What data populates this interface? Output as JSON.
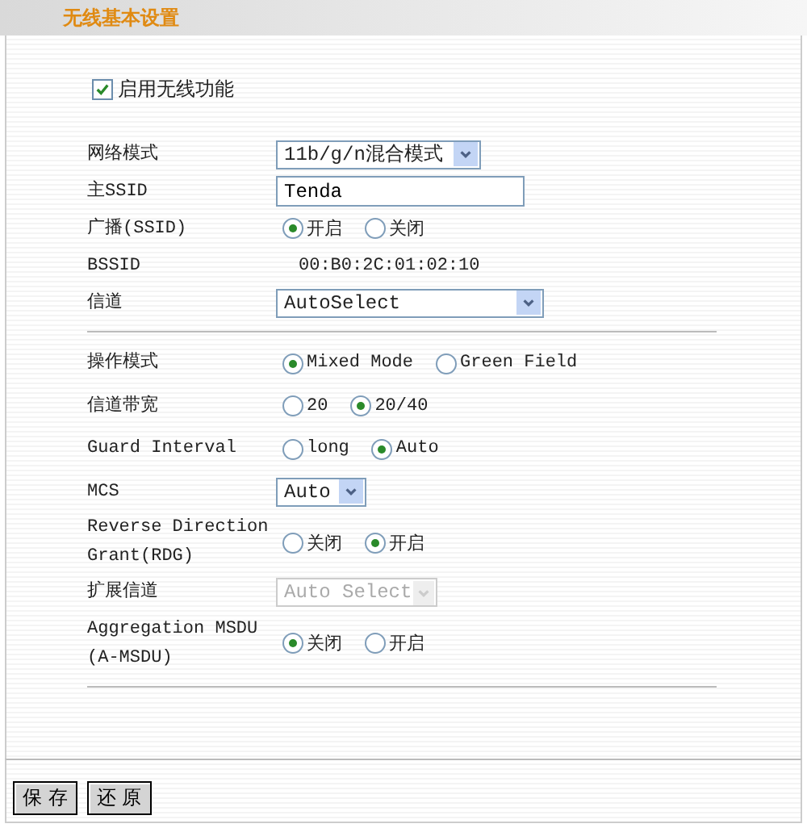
{
  "title": "无线基本设置",
  "enable_wireless": {
    "label": "启用无线功能",
    "checked": true
  },
  "basic_settings": [
    {
      "kind": "select",
      "label": "网络模式",
      "value": "11b/g/n混合模式",
      "disabled": false
    },
    {
      "kind": "input",
      "label": "主SSID",
      "value": "Tenda"
    },
    {
      "kind": "radio",
      "label": "广播(SSID)",
      "options": [
        {
          "label": "开启",
          "selected": true
        },
        {
          "label": "关闭",
          "selected": false
        }
      ]
    },
    {
      "kind": "static",
      "label": "BSSID",
      "value": "00:B0:2C:01:02:10"
    },
    {
      "kind": "select",
      "label": "信道",
      "value": "AutoSelect",
      "disabled": false
    }
  ],
  "advanced_settings": [
    {
      "kind": "radio",
      "label": "操作模式",
      "options": [
        {
          "label": "Mixed Mode",
          "selected": true
        },
        {
          "label": "Green Field",
          "selected": false
        }
      ]
    },
    {
      "kind": "radio",
      "label": "信道带宽",
      "options": [
        {
          "label": "20",
          "selected": false
        },
        {
          "label": "20/40",
          "selected": true
        }
      ]
    },
    {
      "kind": "radio",
      "label": "Guard Interval",
      "options": [
        {
          "label": "long",
          "selected": false
        },
        {
          "label": "Auto",
          "selected": true
        }
      ]
    },
    {
      "kind": "select",
      "label": "MCS",
      "value": "Auto",
      "disabled": false
    },
    {
      "kind": "radio",
      "label": "Reverse Direction Grant(RDG)",
      "options": [
        {
          "label": "关闭",
          "selected": false
        },
        {
          "label": "开启",
          "selected": true
        }
      ]
    },
    {
      "kind": "select",
      "label": "扩展信道",
      "value": "Auto Select",
      "disabled": true
    },
    {
      "kind": "radio",
      "label": "Aggregation MSDU (A-MSDU)",
      "options": [
        {
          "label": "关闭",
          "selected": true
        },
        {
          "label": "开启",
          "selected": false
        }
      ]
    }
  ],
  "buttons": [
    "保 存",
    "还 原"
  ]
}
